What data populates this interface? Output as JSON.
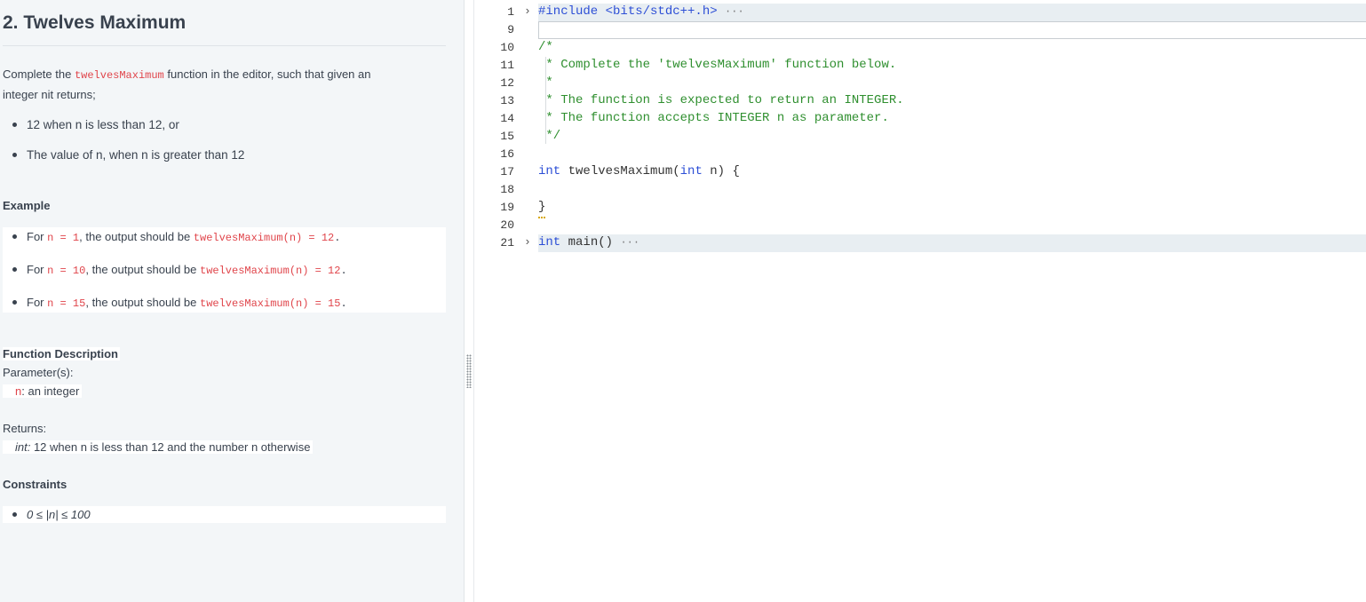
{
  "problem": {
    "title": "2. Twelves Maximum",
    "desc_before": "Complete the ",
    "desc_code": "twelvesMaximum",
    "desc_after": " function in the editor, such that given an",
    "desc_line2": "integer nit returns;",
    "bullets": [
      "12 when n is less than 12, or",
      "The value of n, when n is greater than 12"
    ],
    "example_heading": "Example",
    "examples": [
      {
        "pre": "For ",
        "n_code": "n = 1",
        "mid": ", the output should be ",
        "out_code": "twelvesMaximum(n) = 12",
        "end": "."
      },
      {
        "pre": "For ",
        "n_code": "n = 10",
        "mid": ", the output should be ",
        "out_code": "twelvesMaximum(n) = 12",
        "end": "."
      },
      {
        "pre": "For ",
        "n_code": "n = 15",
        "mid": ", the output should be ",
        "out_code": "twelvesMaximum(n) = 15",
        "end": "."
      }
    ],
    "function_description_heading": "Function Description",
    "parameters_label": "Parameter(s):",
    "param_name": "n",
    "param_desc": ": an integer",
    "returns_label": "Returns:",
    "returns_type": "int:",
    "returns_desc": " 12 when n is less than 12 and the number n otherwise",
    "constraints_heading": "Constraints",
    "constraint": "0 ≤ |n| ≤ 100"
  },
  "editor": {
    "fold_glyph": "›",
    "lines": [
      {
        "num": "1",
        "fold": true,
        "kw": "#include",
        "rest": " <bits/stdc++.h>",
        "ellipsis": "···"
      },
      {
        "num": "9"
      },
      {
        "num": "10",
        "comment": "/*"
      },
      {
        "num": "11",
        "comment": " * Complete the 'twelvesMaximum' function below."
      },
      {
        "num": "12",
        "comment": " *"
      },
      {
        "num": "13",
        "comment": " * The function is expected to return an INTEGER."
      },
      {
        "num": "14",
        "comment": " * The function accepts INTEGER n as parameter."
      },
      {
        "num": "15",
        "comment": " */"
      },
      {
        "num": "16"
      },
      {
        "num": "17",
        "kw": "int",
        "rest": " twelvesMaximum(",
        "kw2": "int",
        "rest2": " n) {"
      },
      {
        "num": "18"
      },
      {
        "num": "19",
        "rest": "}"
      },
      {
        "num": "20"
      },
      {
        "num": "21",
        "fold": true,
        "kw": "int",
        "rest": " main()",
        "ellipsis": "···"
      }
    ]
  }
}
